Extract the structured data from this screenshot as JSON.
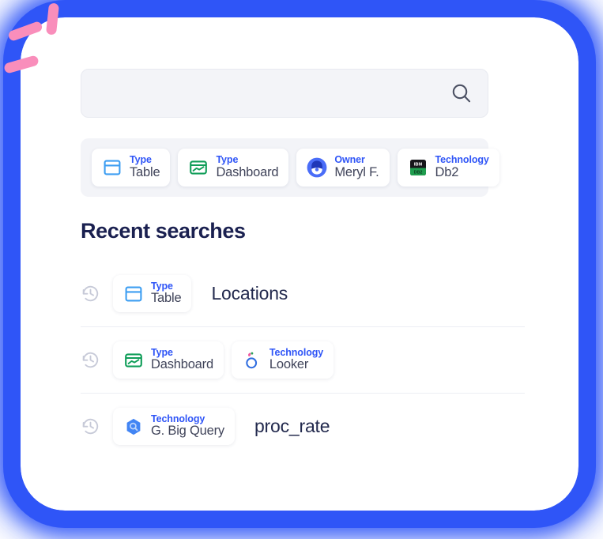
{
  "colors": {
    "accent_blue": "#2f55f7",
    "glow_blue": "#2f55f7",
    "sparkle_pink": "#f98ebb",
    "title_navy": "#1a2050",
    "chip_value_gray": "#40445a",
    "search_bg": "#f3f4f8",
    "divider": "#eceef4",
    "history_gray": "#c7cad8",
    "table_icon_blue": "#3d9ef2",
    "dashboard_icon_green": "#0f9d58",
    "bigquery_blue": "#4285f4",
    "looker_blue": "#2f6de0",
    "looker_pink": "#ef59a0",
    "db2_green": "#1f9d4e",
    "db2_dark": "#16161a"
  },
  "search": {
    "value": "",
    "placeholder": "",
    "icon": "search-icon"
  },
  "suggestion_strip": {
    "chips": [
      {
        "label": "Type",
        "value": "Table",
        "icon": "table-icon"
      },
      {
        "label": "Type",
        "value": "Dashboard",
        "icon": "dashboard-icon"
      },
      {
        "label": "Owner",
        "value": "Meryl F.",
        "icon": "avatar-icon"
      },
      {
        "label": "Technology",
        "value": "Db2",
        "icon": "ibm-db2-icon"
      }
    ]
  },
  "recent": {
    "title": "Recent searches",
    "history_icon": "history-icon",
    "rows": [
      {
        "chips": [
          {
            "label": "Type",
            "value": "Table",
            "icon": "table-icon"
          }
        ],
        "query": "Locations"
      },
      {
        "chips": [
          {
            "label": "Type",
            "value": "Dashboard",
            "icon": "dashboard-icon"
          },
          {
            "label": "Technology",
            "value": "Looker",
            "icon": "looker-icon"
          }
        ],
        "query": ""
      },
      {
        "chips": [
          {
            "label": "Technology",
            "value": "G. Big Query",
            "icon": "bigquery-icon"
          }
        ],
        "query": "proc_rate"
      }
    ]
  },
  "decoration": {
    "sparkles": [
      "sparkle-dash-top",
      "sparkle-dash-middle",
      "sparkle-dash-lower"
    ],
    "glow": "blue-glow-frame"
  }
}
